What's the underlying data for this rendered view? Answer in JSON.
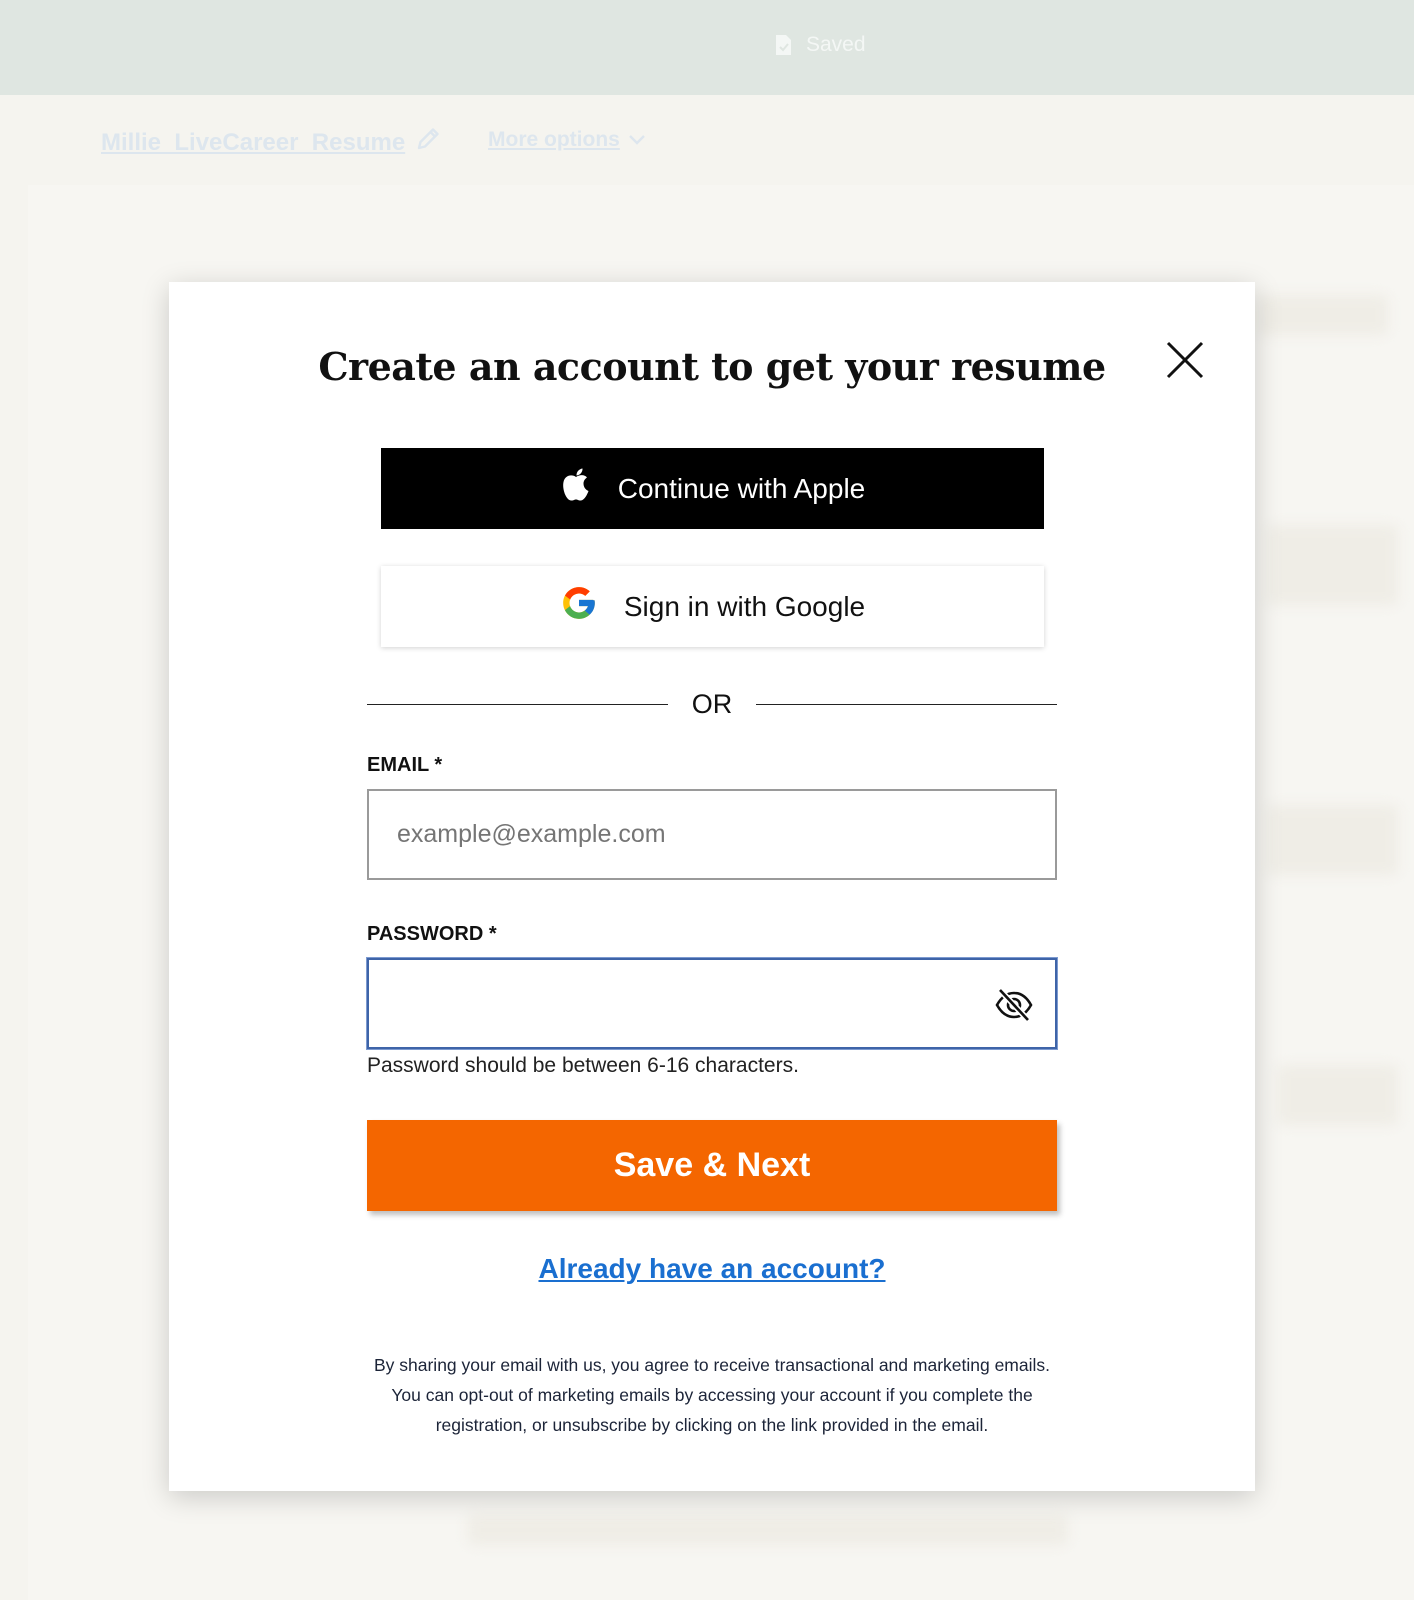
{
  "topbar": {
    "saved_label": "Saved",
    "saved_icon": "document-check-icon"
  },
  "document": {
    "title": "Millie_LiveCareer_Resume",
    "edit_icon": "pencil-icon",
    "more_options_label": "More options"
  },
  "modal": {
    "title": "Create an account to get your resume",
    "close_icon": "close-icon",
    "apple_button_label": "Continue with Apple",
    "google_button_label": "Sign in with Google",
    "or_label": "OR",
    "email": {
      "label": "EMAIL *",
      "placeholder": "example@example.com",
      "value": ""
    },
    "password": {
      "label": "PASSWORD *",
      "value": "",
      "visibility_icon": "eye-slash-icon",
      "hint": "Password should be between 6-16 characters."
    },
    "save_button_label": "Save & Next",
    "login_link_label": "Already have an account?",
    "disclaimer_lines": [
      "By sharing your email with us, you agree to receive transactional and marketing emails.",
      "You can opt-out of marketing emails by accessing your account if you complete the",
      "registration, or unsubscribe by clicking on the link provided in the email."
    ]
  },
  "colors": {
    "accent_orange": "#f46600",
    "link_blue": "#1a6fd0",
    "topbar_bg": "#dfe6e1",
    "focus_border": "#3e64a8"
  }
}
